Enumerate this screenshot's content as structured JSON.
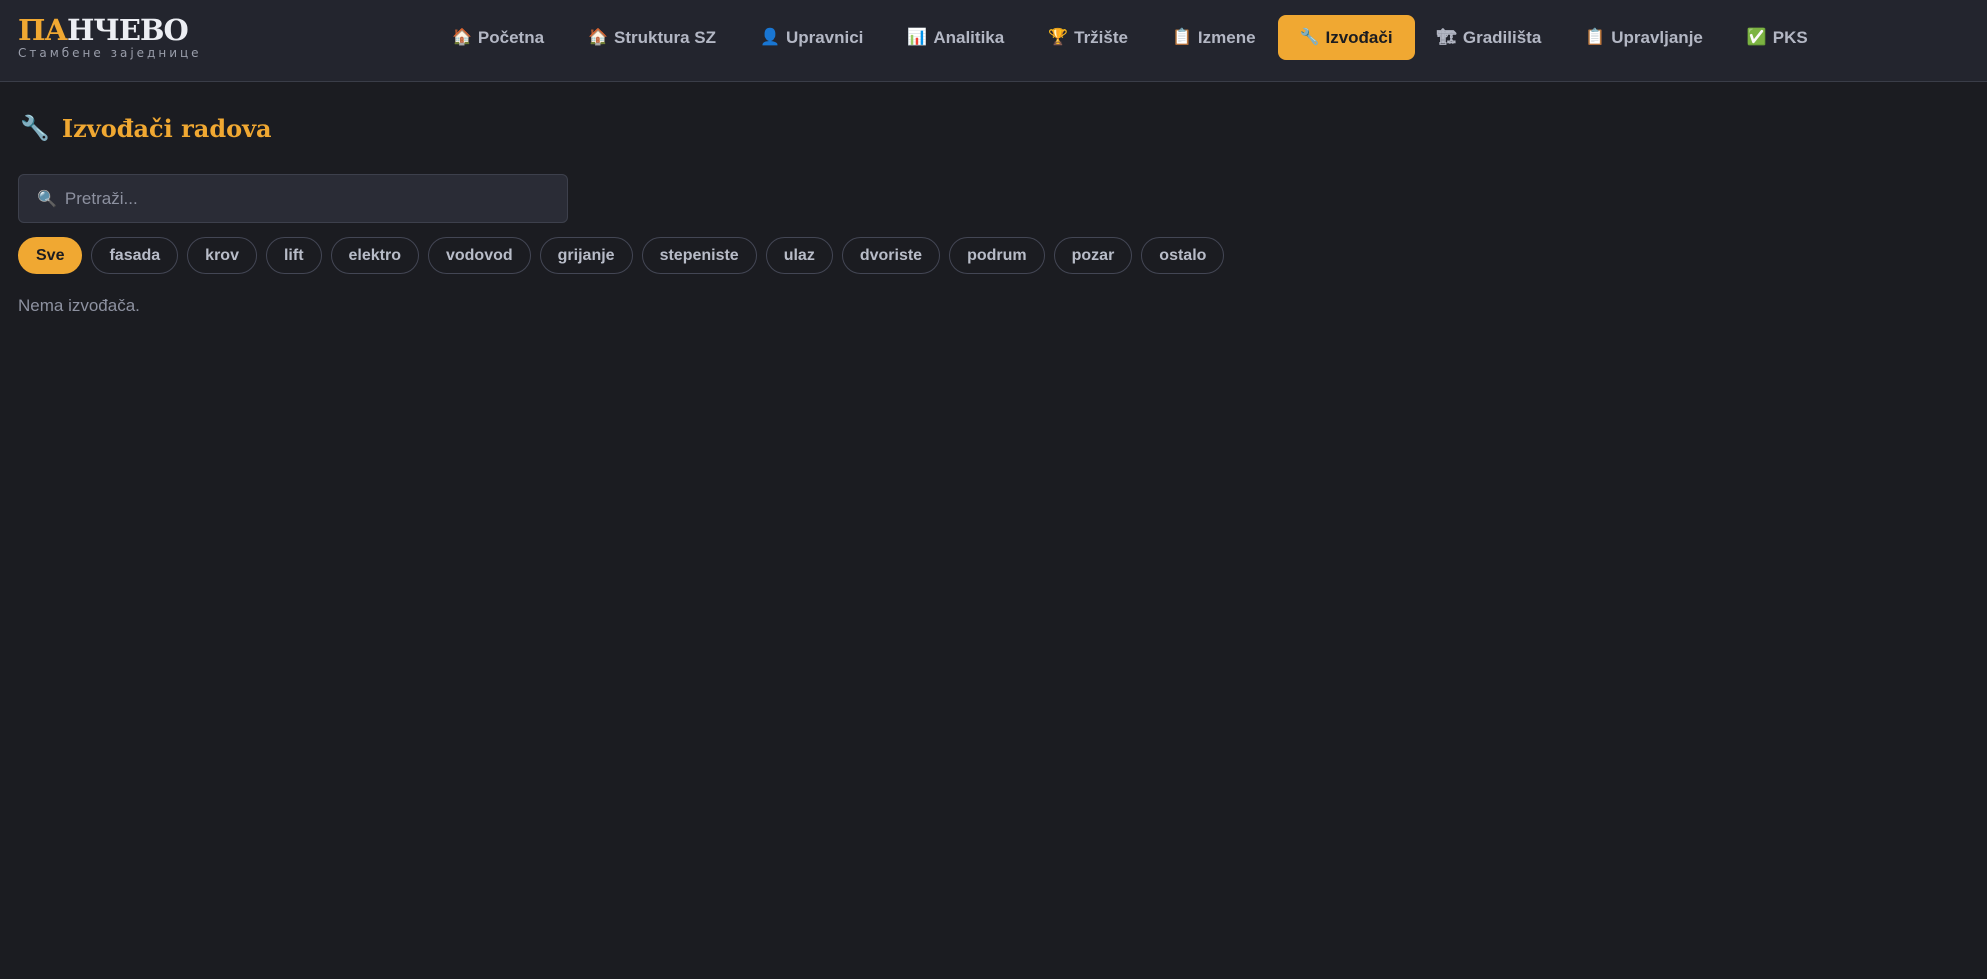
{
  "logo": {
    "accent": "ПА",
    "rest": "НЧЕВО",
    "subtitle": "Стамбене заједнице"
  },
  "nav": [
    {
      "label": "Početna",
      "icon": "🏠",
      "icon_name": "home-icon",
      "active": false
    },
    {
      "label": "Struktura SZ",
      "icon": "🏠",
      "icon_name": "building-structure-icon",
      "active": false
    },
    {
      "label": "Upravnici",
      "icon": "👤",
      "icon_name": "user-icon",
      "active": false
    },
    {
      "label": "Analitika",
      "icon": "📊",
      "icon_name": "chart-icon",
      "active": false
    },
    {
      "label": "Tržište",
      "icon": "🏆",
      "icon_name": "trophy-icon",
      "active": false
    },
    {
      "label": "Izmene",
      "icon": "📋",
      "icon_name": "clipboard-icon",
      "active": false
    },
    {
      "label": "Izvođači",
      "icon": "🔧",
      "icon_name": "wrench-icon",
      "active": true
    },
    {
      "label": "Gradilišta",
      "icon": "🏗",
      "icon_name": "construction-icon",
      "active": false
    },
    {
      "label": "Upravljanje",
      "icon": "📋",
      "icon_name": "clipboard-icon",
      "active": false
    },
    {
      "label": "PKS",
      "icon": "✅",
      "icon_name": "check-icon",
      "active": false
    }
  ],
  "page": {
    "title": "Izvođači radova",
    "title_icon": "🔧"
  },
  "search": {
    "placeholder": "Pretraži...",
    "value": "",
    "icon": "🔍"
  },
  "filters": [
    {
      "label": "Sve",
      "active": true
    },
    {
      "label": "fasada",
      "active": false
    },
    {
      "label": "krov",
      "active": false
    },
    {
      "label": "lift",
      "active": false
    },
    {
      "label": "elektro",
      "active": false
    },
    {
      "label": "vodovod",
      "active": false
    },
    {
      "label": "grijanje",
      "active": false
    },
    {
      "label": "stepeniste",
      "active": false
    },
    {
      "label": "ulaz",
      "active": false
    },
    {
      "label": "dvoriste",
      "active": false
    },
    {
      "label": "podrum",
      "active": false
    },
    {
      "label": "pozar",
      "active": false
    },
    {
      "label": "ostalo",
      "active": false
    }
  ],
  "empty_text": "Nema izvođača.",
  "colors": {
    "accent": "#f0a832",
    "background": "#1b1c21",
    "topbar": "#23252e"
  }
}
